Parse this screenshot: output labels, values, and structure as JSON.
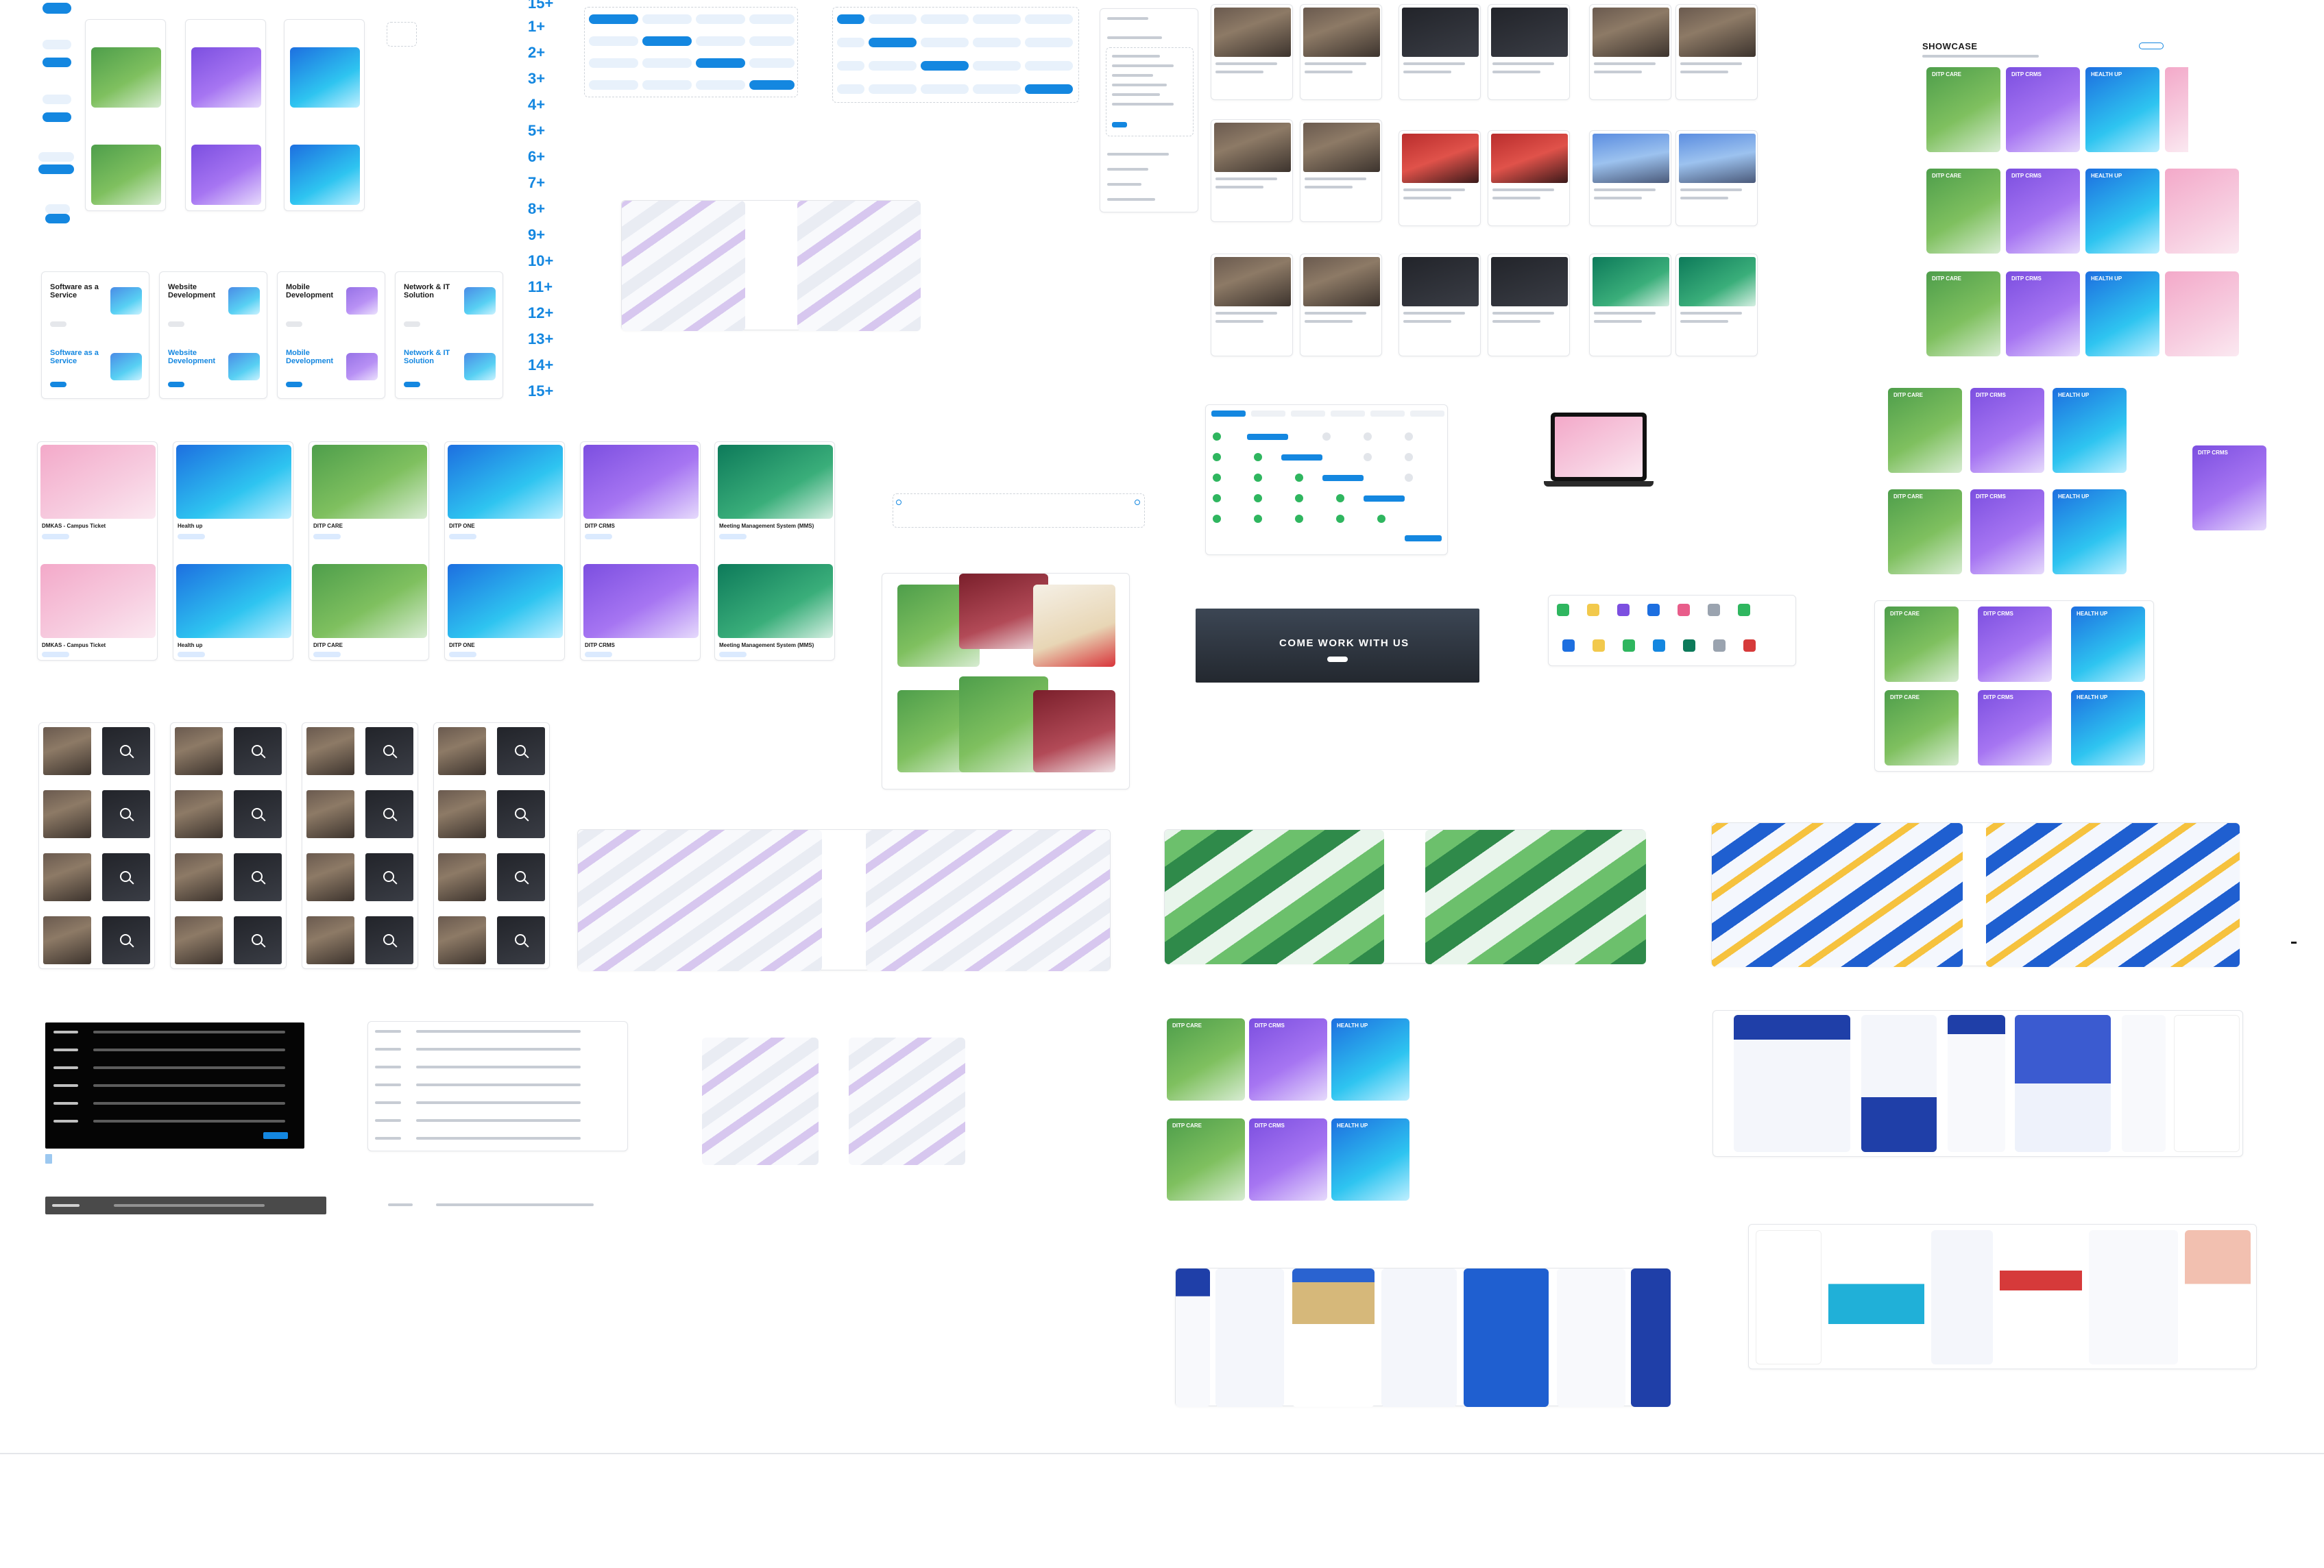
{
  "numbers": [
    "15+",
    "1+",
    "2+",
    "3+",
    "4+",
    "5+",
    "6+",
    "7+",
    "8+",
    "9+",
    "10+",
    "11+",
    "12+",
    "13+",
    "14+",
    "15+"
  ],
  "showcase": {
    "title": "SHOWCASE"
  },
  "banner": {
    "text": "COME WORK WITH US"
  },
  "services": [
    {
      "title": "Software as a Service"
    },
    {
      "title": "Website Development"
    },
    {
      "title": "Mobile Development"
    },
    {
      "title": "Network & IT Solution"
    }
  ],
  "products": [
    {
      "name": "DITP CARE"
    },
    {
      "name": "DITP CRMS"
    },
    {
      "name": "HEALTH UP"
    },
    {
      "name": "Health up"
    }
  ],
  "portfolio_cards": [
    {
      "name": "DMKAS - Campus Ticket"
    },
    {
      "name": "Health up"
    },
    {
      "name": "DITP CARE"
    },
    {
      "name": "DITP ONE"
    },
    {
      "name": "DITP CRMS"
    },
    {
      "name": "Meeting Management System (MMS)"
    }
  ],
  "icons": {
    "zoom": "zoom-in-icon",
    "laptop": "laptop-icon",
    "check": "check-circle-icon"
  },
  "colors": {
    "accent": "#1487e0",
    "green": "#4e9e4b",
    "purple": "#7c4fe0",
    "blue": "#1d6fe0",
    "pink": "#f3a9c9"
  }
}
